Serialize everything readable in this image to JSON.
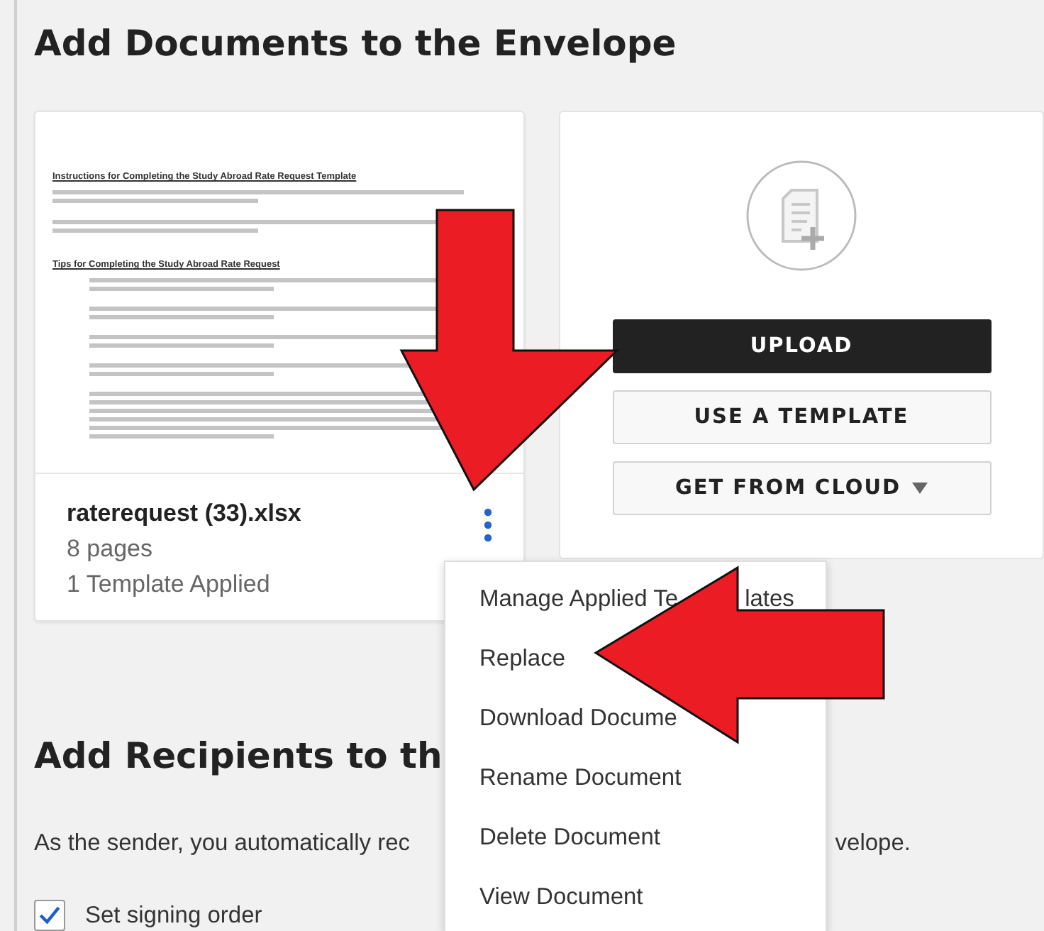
{
  "documents_section": {
    "heading": "Add Documents to the Envelope"
  },
  "document": {
    "preview": {
      "headings": [
        "Instructions for Completing the Study Abroad Rate Request Template",
        "Tips for Completing the Study Abroad Rate Request"
      ]
    },
    "name": "raterequest (33).xlsx",
    "pages": "8 pages",
    "templates": "1 Template Applied"
  },
  "upload_card": {
    "buttons": [
      {
        "label": "UPLOAD",
        "kind": "primary",
        "dropdown": false
      },
      {
        "label": "USE A TEMPLATE",
        "kind": "secondary",
        "dropdown": false
      },
      {
        "label": "GET FROM CLOUD",
        "kind": "secondary",
        "dropdown": true
      }
    ]
  },
  "document_menu": {
    "items": [
      {
        "label_parts": [
          "Manage Applied Te",
          "lates"
        ]
      },
      {
        "label_parts": [
          "Replace"
        ]
      },
      {
        "label_parts": [
          "Download Docume"
        ]
      },
      {
        "label_parts": [
          "Rename Document"
        ]
      },
      {
        "label_parts": [
          "Delete Document"
        ]
      },
      {
        "label_parts": [
          "View Document"
        ]
      }
    ]
  },
  "recipients_section": {
    "heading": "Add Recipients to th",
    "text_parts": [
      "As the sender, you automatically rec",
      "velope."
    ],
    "signing_order": {
      "label": "Set signing order",
      "checked": true
    }
  }
}
